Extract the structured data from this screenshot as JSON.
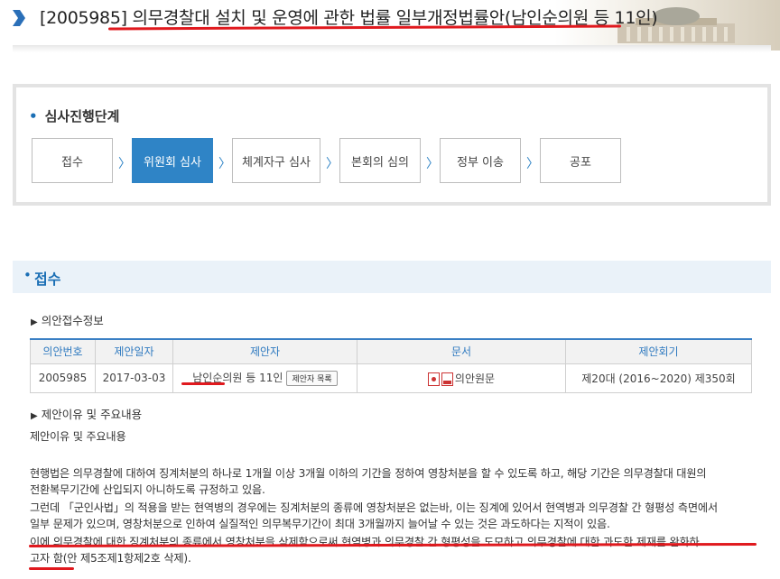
{
  "header": {
    "bill_title": "[2005985] 의무경찰대 설치 및 운영에 관한 법률 일부개정법률안(남인순의원 등 11인)"
  },
  "stages": {
    "title": "심사진행단계",
    "steps": [
      "접수",
      "위원회 심사",
      "체계자구 심사",
      "본회의 심의",
      "정부 이송",
      "공포"
    ],
    "active_index": 1,
    "active_color": "#2f84c6"
  },
  "section": {
    "title": "접수",
    "receipt_info_label": "의안접수정보",
    "table": {
      "headers": [
        "의안번호",
        "제안일자",
        "제안자",
        "문서",
        "제안회기"
      ],
      "row": {
        "bill_no": "2005985",
        "date": "2017-03-03",
        "proposer": "남인순의원 등 11인",
        "proposer_btn": "제안자 목록",
        "doc": "의안원문",
        "session": "제20대 (2016~2020) 제350회"
      }
    },
    "reason_label": "제안이유 및 주요내용",
    "reason_heading": "제안이유 및 주요내용",
    "reason_lines": [
      "현행법은 의무경찰에 대하여 징계처분의 하나로 1개월 이상 3개월 이하의 기간을 정하여 영창처분을 할 수 있도록 하고, 해당 기간은 의무경찰대 대원의",
      "전환복무기간에 산입되지 아니하도록 규정하고 있음.",
      "그런데 「군인사법」의 적용을 받는 현역병의 경우에는 징계처분의 종류에 영창처분은 없는바, 이는 징계에 있어서 현역병과 의무경찰 간 형평성 측면에서",
      "일부 문제가 있으며, 영창처분으로 인하여 실질적인 의무복무기간이 최대 3개월까지 늘어날 수 있는 것은 과도하다는 지적이 있음.",
      "이에 의무경찰에 대한 징계처분의 종류에서 영창처분을 삭제함으로써 현역병과 의무경찰 간 형평성을 도모하고 의무경찰에 대한 과도한 제재를 완화하",
      "고자 함(안 제5조제1항제2호 삭제)."
    ]
  },
  "colors": {
    "accent": "#1b6fb5",
    "highlight": "#e0191e"
  },
  "icons": [
    "chevron-right-icon",
    "hwp-file-icon",
    "pdf-file-icon"
  ]
}
